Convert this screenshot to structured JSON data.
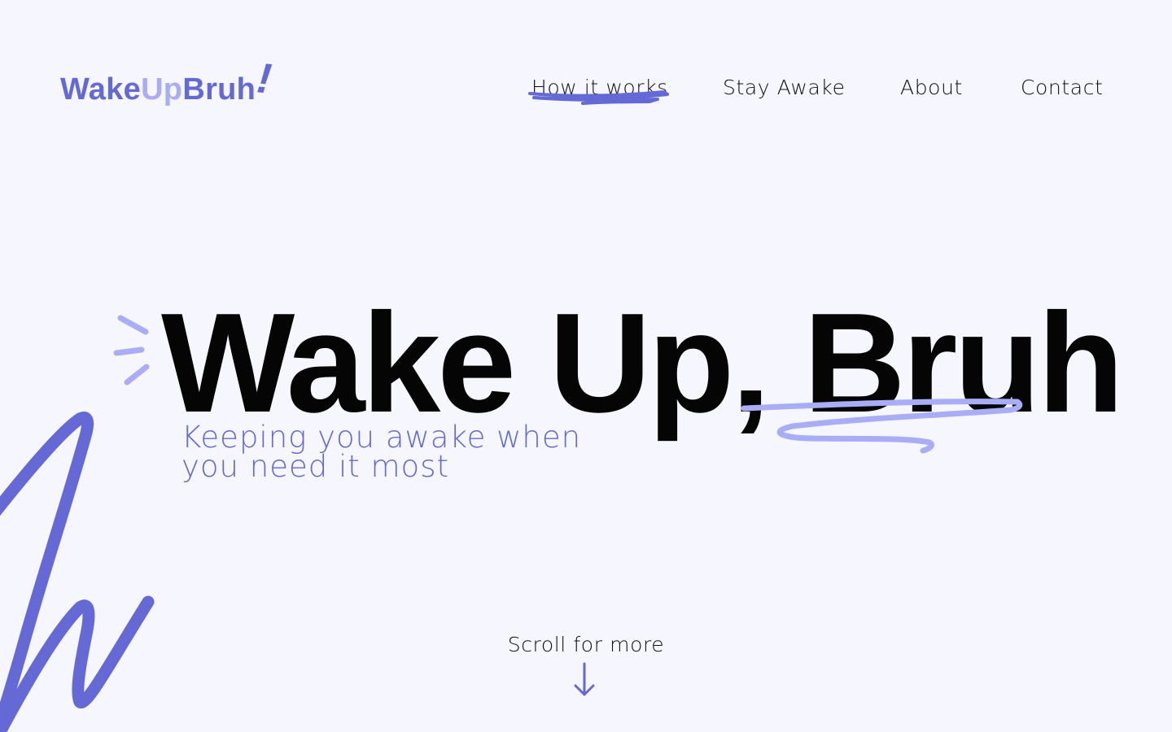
{
  "colors": {
    "background": "#F5F6FE",
    "brand_primary": "#6469D6",
    "brand_light": "#A9ADF6",
    "text": "#0D0D0D"
  },
  "logo": {
    "part1": "Wake",
    "part2": "Up",
    "part3": "Bruh",
    "mark": "!"
  },
  "nav": {
    "items": [
      {
        "label": "How it works",
        "active": true
      },
      {
        "label": "Stay Awake"
      },
      {
        "label": "About"
      },
      {
        "label": "Contact"
      }
    ]
  },
  "hero": {
    "title": "Wake Up, Bruh",
    "subtitle": "Keeping you awake when you need it most"
  },
  "scroll": {
    "label": "Scroll for more",
    "icon": "arrow-down-icon"
  },
  "decorations": {
    "icons": [
      "burst-lines-icon",
      "squiggle-underline-icon",
      "scribble-icon",
      "nav-underline-scribble-icon"
    ]
  }
}
